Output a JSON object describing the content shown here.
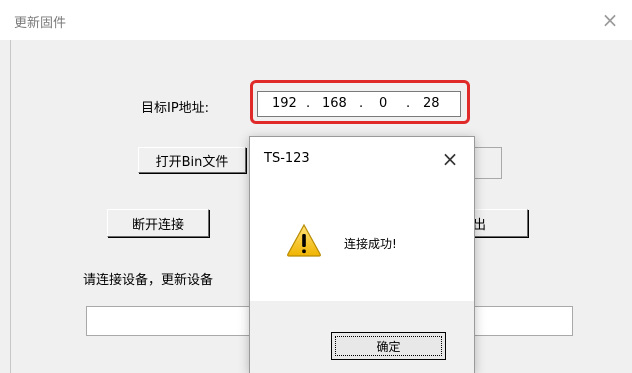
{
  "window": {
    "title": "更新固件",
    "close_glyph": "×"
  },
  "form": {
    "ip_label": "目标IP地址:",
    "ip_segments": [
      "192",
      "168",
      "0",
      "28"
    ],
    "ip_dot": ".",
    "open_bin_button": "打开Bin文件",
    "disconnect_button": "断开连接",
    "exit_button_partial": "退出",
    "status_text": "请连接设备，更新设备"
  },
  "dialog": {
    "title": "TS-123",
    "close_glyph": "×",
    "message": "连接成功!",
    "ok_button": "确定",
    "icon": "warning-icon"
  },
  "colors": {
    "highlight": "#e02a2a",
    "warning_fill": "#f5c518"
  }
}
